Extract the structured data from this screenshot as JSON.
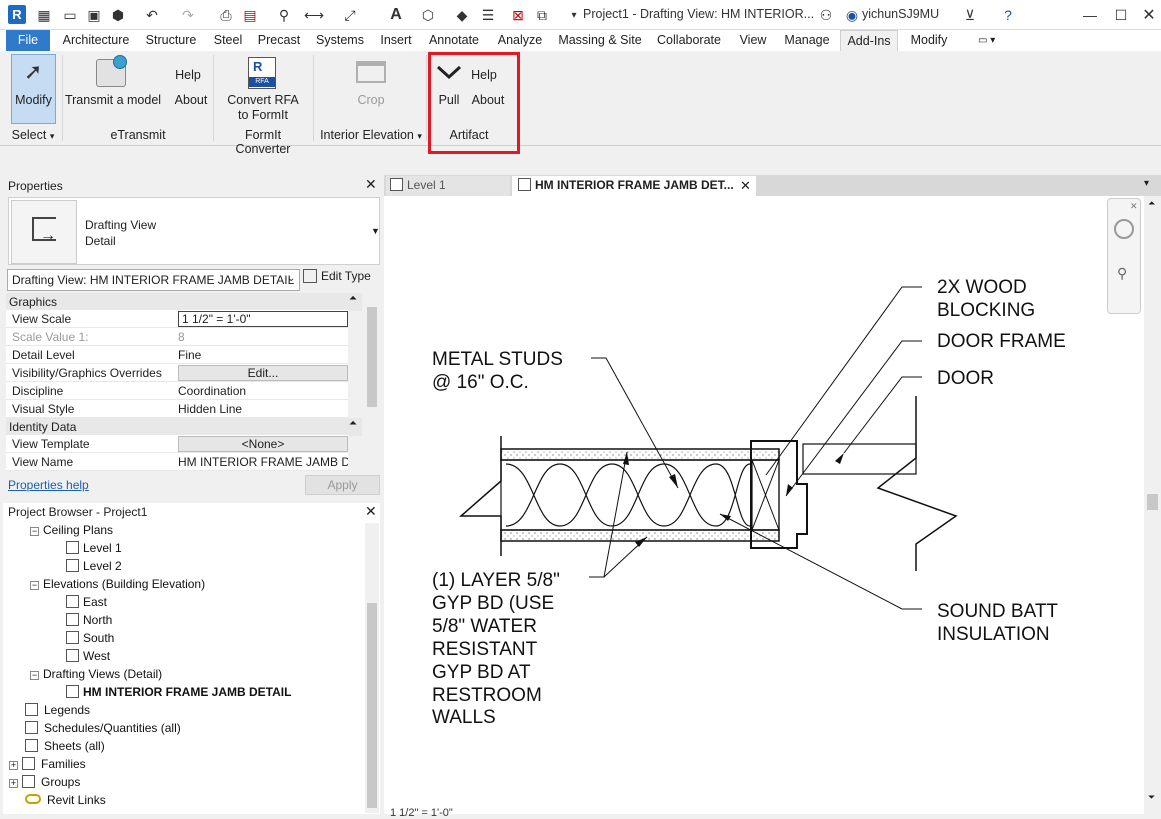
{
  "window": {
    "title": "Project1 - Drafting View: HM INTERIOR...",
    "user": "yichunSJ9MU"
  },
  "ribbon_tabs": [
    "File",
    "Architecture",
    "Structure",
    "Steel",
    "Precast",
    "Systems",
    "Insert",
    "Annotate",
    "Analyze",
    "Massing & Site",
    "Collaborate",
    "View",
    "Manage",
    "Add-Ins",
    "Modify"
  ],
  "ribbon": {
    "modify": "Modify",
    "select_panel": "Select",
    "transmit": "Transmit a model",
    "help1": "Help",
    "about1": "About",
    "etransmit_panel": "eTransmit",
    "convert_line1": "Convert RFA",
    "convert_line2": "to FormIt",
    "formit_panel": "FormIt Converter",
    "crop": "Crop",
    "interior_panel": "Interior Elevation",
    "help2": "Help",
    "pull": "Pull",
    "about2": "About",
    "artifact_panel": "Artifact",
    "rfa_badge": "RFA"
  },
  "properties": {
    "title": "Properties",
    "type_line1": "Drafting View",
    "type_line2": "Detail",
    "selector": "Drafting View: HM INTERIOR FRAME JAMB DETAIL",
    "edit_type": "Edit Type",
    "group_graphics": "Graphics",
    "group_identity": "Identity Data",
    "rows_graphics": [
      {
        "k": "View Scale",
        "v": "1 1/2\" = 1'-0\""
      },
      {
        "k": "Scale Value    1:",
        "v": "8"
      },
      {
        "k": "Detail Level",
        "v": "Fine"
      },
      {
        "k": "Visibility/Graphics Overrides",
        "v": "Edit..."
      },
      {
        "k": "Discipline",
        "v": "Coordination"
      },
      {
        "k": "Visual Style",
        "v": "Hidden Line"
      }
    ],
    "rows_identity": [
      {
        "k": "View Template",
        "v": "<None>"
      },
      {
        "k": "View Name",
        "v": "HM INTERIOR FRAME JAMB D..."
      }
    ],
    "help_link": "Properties help",
    "apply": "Apply"
  },
  "browser": {
    "title": "Project Browser - Project1",
    "items": [
      "Ceiling Plans",
      "Level 1",
      "Level 2",
      "Elevations (Building Elevation)",
      "East",
      "North",
      "South",
      "West",
      "Drafting Views (Detail)",
      "HM INTERIOR FRAME JAMB DETAIL",
      "Legends",
      "Schedules/Quantities (all)",
      "Sheets (all)",
      "Families",
      "Groups",
      "Revit Links"
    ]
  },
  "view_tabs": [
    "Level 1",
    "HM INTERIOR FRAME JAMB DET..."
  ],
  "drawing": {
    "labels": {
      "metal_studs_1": "METAL STUDS",
      "metal_studs_2": "@ 16\" O.C.",
      "wood_blocking_1": "2X WOOD",
      "wood_blocking_2": "BLOCKING",
      "door_frame": "DOOR FRAME",
      "door": "DOOR",
      "gyp_1": "(1) LAYER 5/8\"",
      "gyp_2": "GYP BD (USE",
      "gyp_3": "5/8\" WATER",
      "gyp_4": "RESISTANT",
      "gyp_5": "GYP BD AT",
      "gyp_6": "RESTROOM",
      "gyp_7": "WALLS",
      "sound_1": "SOUND BATT",
      "sound_2": "INSULATION"
    }
  },
  "statusbar": {
    "scale": "1 1/2\" = 1'-0\""
  },
  "colors": {
    "file_tab": "#2f7bc9",
    "highlight": "#e01a24",
    "link": "#1a5fb4"
  }
}
